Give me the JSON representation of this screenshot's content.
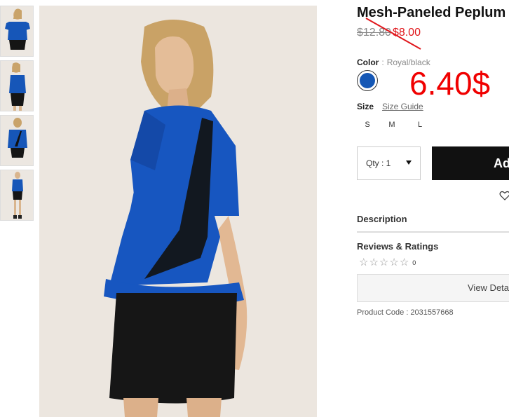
{
  "product": {
    "title": "Mesh-Paneled Peplum",
    "price_old": "$12.80",
    "price_new": "$8.00",
    "handwritten_price": "6.40$",
    "color_label": "Color",
    "color_sep": ":",
    "color_value": "Royal/black",
    "swatch_color": "#1557b5",
    "size_label": "Size",
    "size_guide": "Size Guide",
    "sizes": [
      "S",
      "M",
      "L"
    ],
    "qty_label": "Qty : 1",
    "add_button": "Add",
    "description": "Description",
    "reviews_title": "Reviews & Ratings",
    "review_count": "0",
    "view_details": "View Deta",
    "product_code": "Product Code : 2031557668"
  },
  "colors": {
    "accent_red": "#e0161b",
    "annotation_red": "#f00000",
    "button_black": "#111111"
  },
  "thumbnails": [
    {
      "name": "front-view"
    },
    {
      "name": "side-view"
    },
    {
      "name": "back-view"
    },
    {
      "name": "full-length-view"
    }
  ]
}
